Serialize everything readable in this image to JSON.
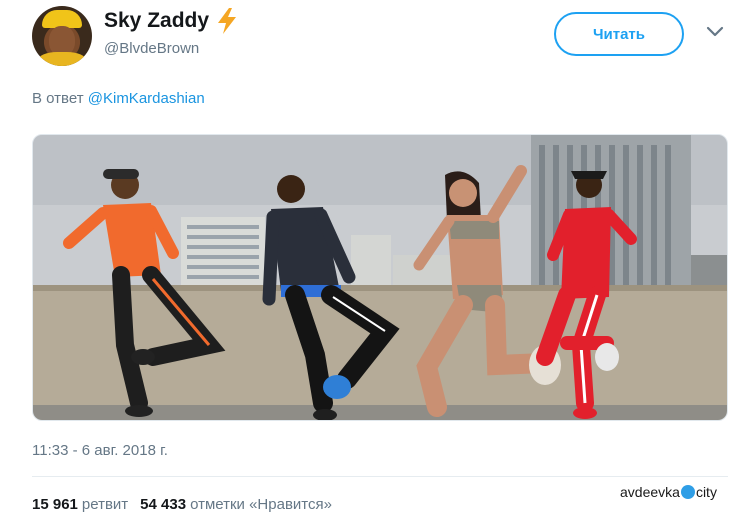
{
  "user": {
    "display_name": "Sky Zaddy",
    "badge_icon": "lightning-bolt-icon",
    "handle": "@BlvdeBrown"
  },
  "follow_button": {
    "label": "Читать"
  },
  "menu_icon": "chevron-down-icon",
  "reply": {
    "prefix": "В ответ",
    "mention": "@KimKardashian"
  },
  "photo": {
    "description_icon": "photo"
  },
  "timestamp": "11:33 - 6 авг. 2018 г.",
  "stats": {
    "retweets_count": "15 961",
    "retweets_label": "ретвит",
    "likes_count": "54 433",
    "likes_label": "отметки «Нравится»"
  },
  "watermark": {
    "left": "avdeevka",
    "right": "city"
  },
  "colors": {
    "accent": "#1da1f2",
    "mention": "#1b95e0",
    "secondary_text": "#657786"
  }
}
